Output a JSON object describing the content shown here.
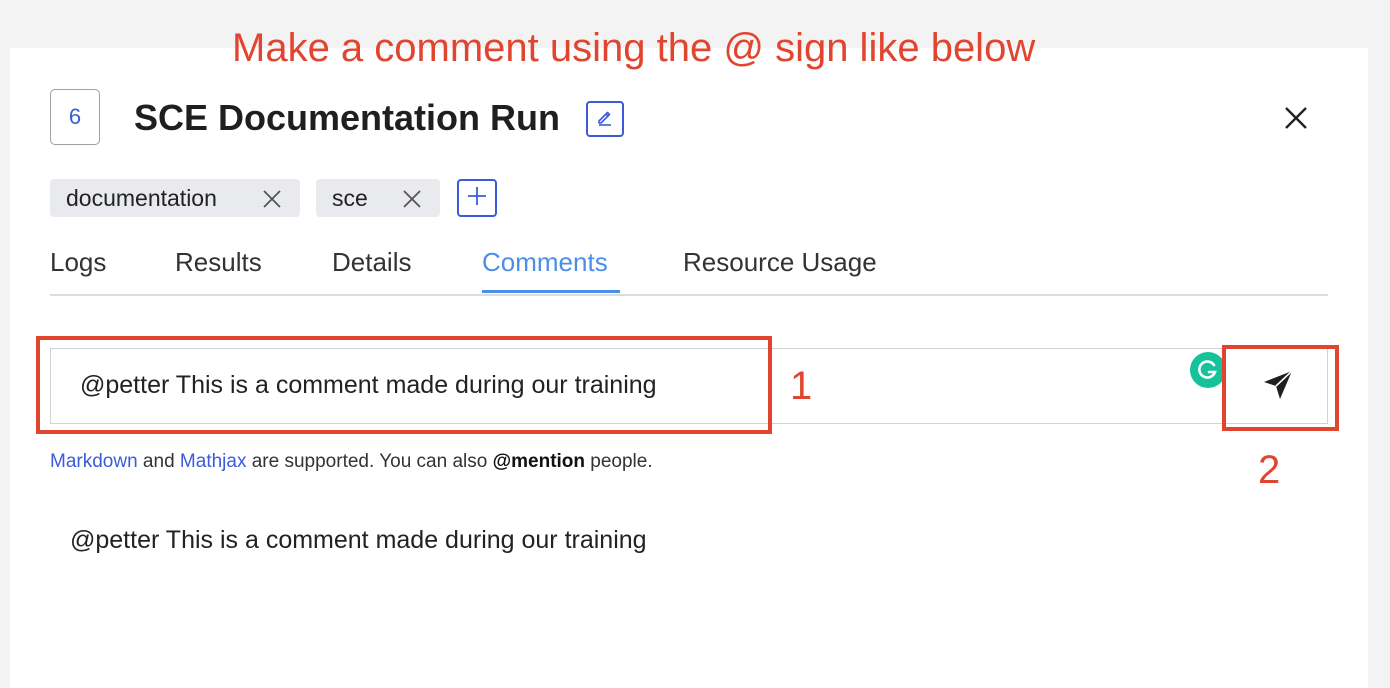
{
  "annotation": {
    "title": "Make a comment using the @ sign like below",
    "step1": "1",
    "step2": "2",
    "color": "#e2452f"
  },
  "run": {
    "number": "6",
    "title": "SCE Documentation Run"
  },
  "tags": [
    {
      "label": "documentation"
    },
    {
      "label": "sce"
    }
  ],
  "tabs": [
    {
      "label": "Logs",
      "active": false
    },
    {
      "label": "Results",
      "active": false
    },
    {
      "label": "Details",
      "active": false
    },
    {
      "label": "Comments",
      "active": true
    },
    {
      "label": "Resource Usage",
      "active": false
    }
  ],
  "comment_box": {
    "value": "@petter This is a comment made during our training"
  },
  "help": {
    "markdown": "Markdown",
    "and": " and ",
    "mathjax": "Mathjax",
    "supported": " are supported. You can also ",
    "mention": "@mention",
    "people": " people."
  },
  "comments": [
    {
      "text": "@petter This is a comment made during our training"
    }
  ],
  "icons": {
    "edit": "pencil-icon",
    "close": "close-icon",
    "tag_remove": "close-icon",
    "add_tag": "plus-icon",
    "send": "send-icon",
    "grammarly": "grammarly-icon"
  },
  "colors": {
    "accent": "#3b5bdb",
    "active_tab": "#4a8ee8",
    "grammarly": "#15c39a"
  }
}
